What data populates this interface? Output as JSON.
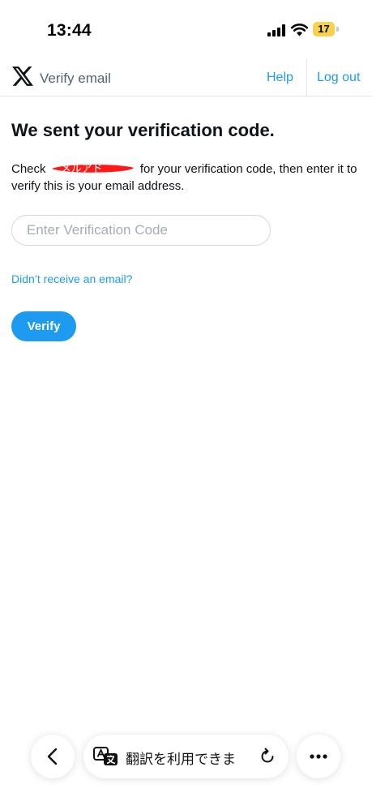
{
  "status_bar": {
    "time": "13:44",
    "battery": "17"
  },
  "header": {
    "title": "Verify email",
    "help_label": "Help",
    "logout_label": "Log out"
  },
  "main": {
    "heading": "We sent your verification code.",
    "instruction_prefix": "Check",
    "redacted_email": "メルアド",
    "instruction_suffix": " for your verification code, then enter it to verify this is your email address.",
    "code_input": {
      "placeholder": "Enter Verification Code",
      "value": ""
    },
    "resend_link": "Didn’t receive an email?",
    "verify_label": "Verify"
  },
  "browser": {
    "translate_text": "翻訳を利用できま",
    "icons": [
      "chevron-left-icon",
      "translate-icon",
      "reload-icon",
      "more-icon"
    ]
  },
  "colors": {
    "accent": "#1d9bf0",
    "text": "#0f1419",
    "muted": "#536471",
    "battery": "#f7d24a",
    "redaction": "#ff1a1a"
  }
}
